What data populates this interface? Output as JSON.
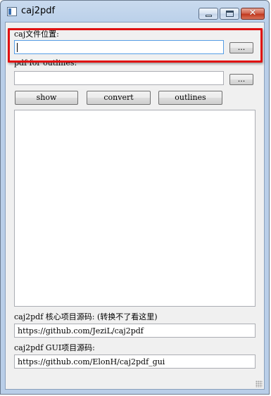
{
  "window": {
    "title": "caj2pdf"
  },
  "caj_section": {
    "label": "caj文件位置:",
    "value": "",
    "browse_label": "..."
  },
  "pdf_section": {
    "label": "pdf for outlines:",
    "value": "",
    "browse_label": "..."
  },
  "actions": {
    "show_label": "show",
    "convert_label": "convert",
    "outlines_label": "outlines"
  },
  "output": {
    "text": ""
  },
  "links": {
    "core_label": "caj2pdf 核心项目源码: (转换不了看这里)",
    "core_url": "https://github.com/JeziL/caj2pdf",
    "gui_label": "caj2pdf GUI项目源码:",
    "gui_url": "https://github.com/ElonH/caj2pdf_gui"
  },
  "annotation": {
    "highlight_color": "#e01010"
  }
}
